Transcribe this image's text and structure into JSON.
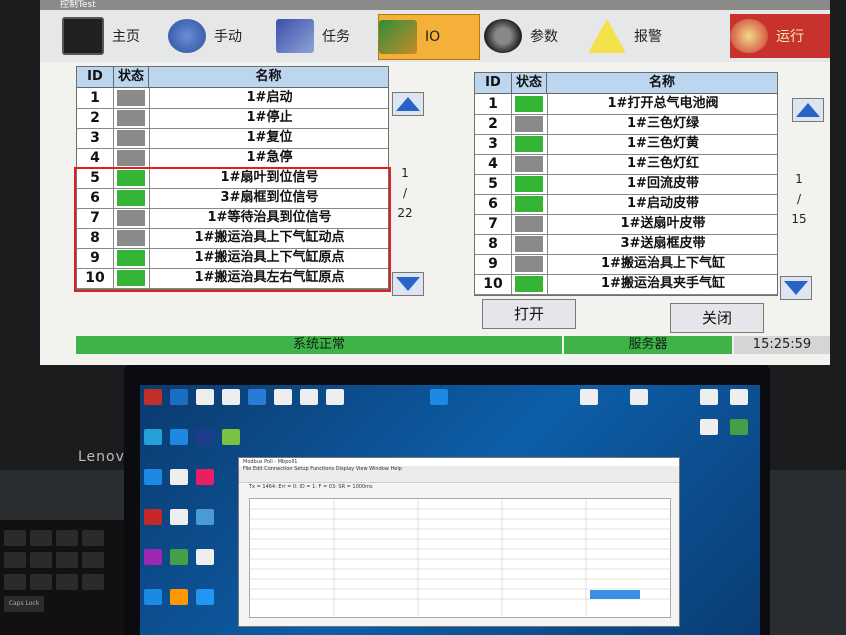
{
  "window_title": "控制Test",
  "nav": [
    {
      "label": "主页",
      "icon": "monitor-icon"
    },
    {
      "label": "手动",
      "icon": "hand-icon"
    },
    {
      "label": "任务",
      "icon": "tasks-icon"
    },
    {
      "label": "IO",
      "icon": "io-icon",
      "active": true
    },
    {
      "label": "参数",
      "icon": "gear-icon"
    },
    {
      "label": "报警",
      "icon": "warning-icon"
    },
    {
      "label": "运行",
      "icon": "run-icon"
    }
  ],
  "left_table": {
    "headers": {
      "id": "ID",
      "state": "状态",
      "name": "名称"
    },
    "rows": [
      {
        "id": "1",
        "state": "off",
        "name": "1#启动"
      },
      {
        "id": "2",
        "state": "off",
        "name": "1#停止"
      },
      {
        "id": "3",
        "state": "off",
        "name": "1#复位"
      },
      {
        "id": "4",
        "state": "off",
        "name": "1#急停"
      },
      {
        "id": "5",
        "state": "on",
        "name": "1#扇叶到位信号"
      },
      {
        "id": "6",
        "state": "on",
        "name": "3#扇框到位信号"
      },
      {
        "id": "7",
        "state": "off",
        "name": "1#等待治具到位信号"
      },
      {
        "id": "8",
        "state": "off",
        "name": "1#搬运治具上下气缸动点"
      },
      {
        "id": "9",
        "state": "on",
        "name": "1#搬运治具上下气缸原点"
      },
      {
        "id": "10",
        "state": "on",
        "name": "1#搬运治具左右气缸原点"
      }
    ],
    "page_current": "1",
    "page_sep": "/",
    "page_total": "22"
  },
  "right_table": {
    "headers": {
      "id": "ID",
      "state": "状态",
      "name": "名称"
    },
    "rows": [
      {
        "id": "1",
        "state": "on",
        "name": "1#打开总气电池阀"
      },
      {
        "id": "2",
        "state": "off",
        "name": "1#三色灯绿"
      },
      {
        "id": "3",
        "state": "on",
        "name": "1#三色灯黄"
      },
      {
        "id": "4",
        "state": "off",
        "name": "1#三色灯红"
      },
      {
        "id": "5",
        "state": "on",
        "name": "1#回流皮带"
      },
      {
        "id": "6",
        "state": "on",
        "name": "1#启动皮带"
      },
      {
        "id": "7",
        "state": "off",
        "name": "1#送扇叶皮带"
      },
      {
        "id": "8",
        "state": "off",
        "name": "3#送扇框皮带"
      },
      {
        "id": "9",
        "state": "off",
        "name": "1#搬运治具上下气缸"
      },
      {
        "id": "10",
        "state": "on",
        "name": "1#搬运治具夹手气缸"
      }
    ],
    "page_current": "1",
    "page_sep": "/",
    "page_total": "15"
  },
  "buttons": {
    "open": "打开",
    "close": "关闭"
  },
  "status_bar": {
    "system": "系统正常",
    "server": "服务器",
    "time": "15:25:59"
  },
  "monitor_brand": "Lenovo",
  "laptop": {
    "window_title": "Modbus Poll - Mbpoll1",
    "menu": "File  Edit  Connection  Setup  Functions  Display  View  Window  Help",
    "sub_title": "Mbpoll1",
    "status_line": "Tx = 1464: Err = 0: ID = 1: F = 03: SR = 1000ms"
  },
  "keyboard": {
    "caps_label": "Caps Lock"
  }
}
